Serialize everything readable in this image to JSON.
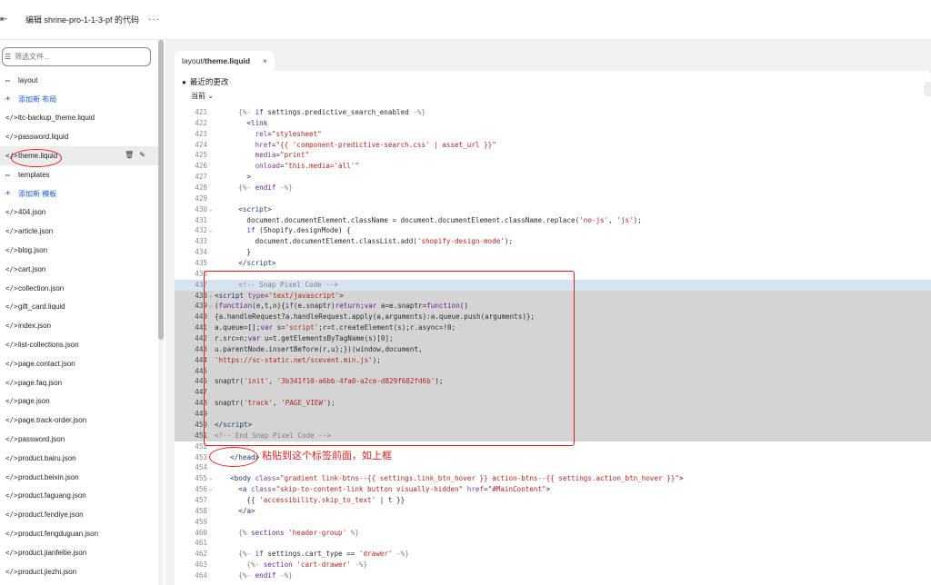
{
  "topbar": {
    "title": "编辑 shrine-pro-1-1-3-pf 的代码",
    "more": "···",
    "back_icon": "exit-icon"
  },
  "sidebar": {
    "filter_placeholder": "筛选文件...",
    "items": [
      {
        "icon": "folder",
        "label": "layout",
        "type": "folder"
      },
      {
        "icon": "plus",
        "label": "添加新 布局",
        "type": "add"
      },
      {
        "icon": "code",
        "label": "ltc-backup_theme.liquid",
        "type": "file"
      },
      {
        "icon": "code",
        "label": "password.liquid",
        "type": "file"
      },
      {
        "icon": "code",
        "label": "theme.liquid",
        "type": "file",
        "active": true
      },
      {
        "icon": "folder",
        "label": "templates",
        "type": "folder"
      },
      {
        "icon": "plus",
        "label": "添加新 模板",
        "type": "add"
      },
      {
        "icon": "code",
        "label": "404.json",
        "type": "file"
      },
      {
        "icon": "code",
        "label": "article.json",
        "type": "file"
      },
      {
        "icon": "code",
        "label": "blog.json",
        "type": "file"
      },
      {
        "icon": "code",
        "label": "cart.json",
        "type": "file"
      },
      {
        "icon": "code",
        "label": "collection.json",
        "type": "file"
      },
      {
        "icon": "code",
        "label": "gift_card.liquid",
        "type": "file"
      },
      {
        "icon": "code",
        "label": "index.json",
        "type": "file"
      },
      {
        "icon": "code",
        "label": "list-collections.json",
        "type": "file"
      },
      {
        "icon": "code",
        "label": "page.contact.json",
        "type": "file"
      },
      {
        "icon": "code",
        "label": "page.faq.json",
        "type": "file"
      },
      {
        "icon": "code",
        "label": "page.json",
        "type": "file"
      },
      {
        "icon": "code",
        "label": "page.track-order.json",
        "type": "file"
      },
      {
        "icon": "code",
        "label": "password.json",
        "type": "file"
      },
      {
        "icon": "code",
        "label": "product.bairu.json",
        "type": "file"
      },
      {
        "icon": "code",
        "label": "product.beixin.json",
        "type": "file"
      },
      {
        "icon": "code",
        "label": "product.faguang.json",
        "type": "file"
      },
      {
        "icon": "code",
        "label": "product.fendiye.json",
        "type": "file"
      },
      {
        "icon": "code",
        "label": "product.fengduguan.json",
        "type": "file"
      },
      {
        "icon": "code",
        "label": "product.jianfeitie.json",
        "type": "file"
      },
      {
        "icon": "code",
        "label": "product.jiezhi.json",
        "type": "file"
      }
    ]
  },
  "editor": {
    "tab_prefix": "layout/",
    "tab_file": "theme.liquid",
    "tab_close": "×",
    "recent_label": "最近的更改",
    "dropdown_value": "当前 ⌄",
    "lines": [
      {
        "n": "421",
        "f": "",
        "h": "    <span class=\"c\">{%-</span> <span class=\"k\">if</span> settings.predictive_search_enabled <span class=\"c\">-%}</span>"
      },
      {
        "n": "422",
        "f": "",
        "h": "      &lt;<span class=\"t\">link</span>"
      },
      {
        "n": "423",
        "f": "",
        "h": "        <span class=\"a\">rel</span>=<span class=\"s\">\"stylesheet\"</span>"
      },
      {
        "n": "424",
        "f": "",
        "h": "        <span class=\"a\">href</span>=<span class=\"s\">\"{{ 'component-predictive-search.css' | asset_url }}\"</span>"
      },
      {
        "n": "425",
        "f": "",
        "h": "        <span class=\"a\">media</span>=<span class=\"s\">\"print\"</span>"
      },
      {
        "n": "426",
        "f": "",
        "h": "        <span class=\"a\">onload</span>=<span class=\"s\">\"this.media='all'\"</span>"
      },
      {
        "n": "427",
        "f": "",
        "h": "      &gt;"
      },
      {
        "n": "428",
        "f": "",
        "h": "    <span class=\"c\">{%-</span> <span class=\"k\">endif</span> <span class=\"c\">-%}</span>"
      },
      {
        "n": "429",
        "f": "",
        "h": ""
      },
      {
        "n": "430",
        "f": "⌄",
        "h": "    &lt;<span class=\"t\">script</span>&gt;"
      },
      {
        "n": "431",
        "f": "",
        "h": "      document.documentElement.className = document.documentElement.className.replace(<span class=\"s\">'no-js'</span>, <span class=\"s\">'js'</span>);"
      },
      {
        "n": "432",
        "f": "⌄",
        "h": "      <span class=\"k\">if</span> (Shopify.designMode) {"
      },
      {
        "n": "433",
        "f": "",
        "h": "        document.documentElement.classList.add(<span class=\"s\">'shopify-design-mode'</span>);"
      },
      {
        "n": "434",
        "f": "",
        "h": "      }"
      },
      {
        "n": "435",
        "f": "",
        "h": "    &lt;/<span class=\"t\">script</span>&gt;"
      },
      {
        "n": "436",
        "f": "",
        "h": ""
      },
      {
        "n": "437",
        "f": "",
        "hl": "first",
        "h": "    <span class=\"c\">&lt;!-- Snap Pixel Code --&gt;</span>"
      },
      {
        "n": "438",
        "f": "⌄",
        "hl": "block",
        "h": "&lt;<span class=\"t\">script</span> <span class=\"a\">type</span>=<span class=\"s\">'text/javascript'</span>&gt;"
      },
      {
        "n": "439",
        "f": "⌄",
        "hl": "block",
        "h": "(<span class=\"k\">function</span>(e,t,n){<span class=\"k\">if</span>(e.snaptr)<span class=\"k\">return</span>;<span class=\"k\">var</span> a=e.snaptr=<span class=\"k\">function</span>()"
      },
      {
        "n": "440",
        "f": "",
        "hl": "block",
        "h": "{a.handleRequest?a.handleRequest.apply(a,arguments):a.queue.push(arguments)};"
      },
      {
        "n": "441",
        "f": "",
        "hl": "block",
        "h": "a.queue=[];<span class=\"k\">var</span> s=<span class=\"s\">'script'</span>;r=t.createElement(s);r.async=!0;"
      },
      {
        "n": "442",
        "f": "",
        "hl": "block",
        "h": "r.src=n;<span class=\"k\">var</span> u=t.getElementsByTagName(s)[0];"
      },
      {
        "n": "443",
        "f": "",
        "hl": "block",
        "h": "u.parentNode.insertBefore(r,u);})(window,document,"
      },
      {
        "n": "444",
        "f": "",
        "hl": "block",
        "h": "<span class=\"s\">'https://sc-static.net/scevent.min.js'</span>);"
      },
      {
        "n": "445",
        "f": "",
        "hl": "block",
        "h": ""
      },
      {
        "n": "446",
        "f": "",
        "hl": "block",
        "h": "snaptr(<span class=\"s\">'init'</span>, <span class=\"s\">'3b341f10-a6bb-4fa0-a2ce-d829f682fd6b'</span>);"
      },
      {
        "n": "447",
        "f": "",
        "hl": "block",
        "h": ""
      },
      {
        "n": "448",
        "f": "",
        "hl": "block",
        "h": "snaptr(<span class=\"s\">'track'</span>, <span class=\"s\">'PAGE_VIEW'</span>);"
      },
      {
        "n": "449",
        "f": "",
        "hl": "block",
        "h": ""
      },
      {
        "n": "450",
        "f": "",
        "hl": "block",
        "h": "&lt;/<span class=\"t\">script</span>&gt;"
      },
      {
        "n": "451",
        "f": "",
        "hl": "block",
        "h": "<span class=\"c\">&lt;!-- End Snap Pixel Code --&gt;</span>"
      },
      {
        "n": "452",
        "f": "",
        "h": ""
      },
      {
        "n": "453",
        "f": "",
        "h": "  &lt;/<span class=\"t\">head</span>&gt;"
      },
      {
        "n": "454",
        "f": "",
        "h": ""
      },
      {
        "n": "455",
        "f": "⌄",
        "h": "  &lt;<span class=\"t\">body</span> <span class=\"a\">class</span>=<span class=\"s\">\"gradient link-btns--{{ settings.link_btn_hover }} action-btns--{{ settings.action_btn_hover }}\"</span>&gt;"
      },
      {
        "n": "456",
        "f": "⌄",
        "h": "    &lt;<span class=\"t\">a</span> <span class=\"a\">class</span>=<span class=\"s\">\"skip-to-content-link button visually-hidden\"</span> <span class=\"a\">href</span>=<span class=\"s\">\"#MainContent\"</span>&gt;"
      },
      {
        "n": "457",
        "f": "",
        "h": "      {{ <span class=\"s\">'accessibility.skip_to_text'</span> | t }}"
      },
      {
        "n": "458",
        "f": "",
        "h": "    &lt;/<span class=\"t\">a</span>&gt;"
      },
      {
        "n": "459",
        "f": "",
        "h": ""
      },
      {
        "n": "460",
        "f": "",
        "h": "    <span class=\"c\">{%</span> <span class=\"k\">sections</span> <span class=\"s\">'header-group'</span> <span class=\"c\">%}</span>"
      },
      {
        "n": "461",
        "f": "",
        "h": ""
      },
      {
        "n": "462",
        "f": "",
        "h": "    <span class=\"c\">{%-</span> <span class=\"k\">if</span> settings.cart_type == <span class=\"s\">'drawer'</span> <span class=\"c\">-%}</span>"
      },
      {
        "n": "463",
        "f": "",
        "h": "      <span class=\"c\">{%-</span> <span class=\"k\">section</span> <span class=\"s\">'cart-drawer'</span> <span class=\"c\">-%}</span>"
      },
      {
        "n": "464",
        "f": "",
        "h": "    <span class=\"c\">{%-</span> <span class=\"k\">endif</span> <span class=\"c\">-%}</span>"
      }
    ]
  },
  "annotation": {
    "note": "粘贴到这个标签前面，如上框",
    "color": "#e02020"
  }
}
